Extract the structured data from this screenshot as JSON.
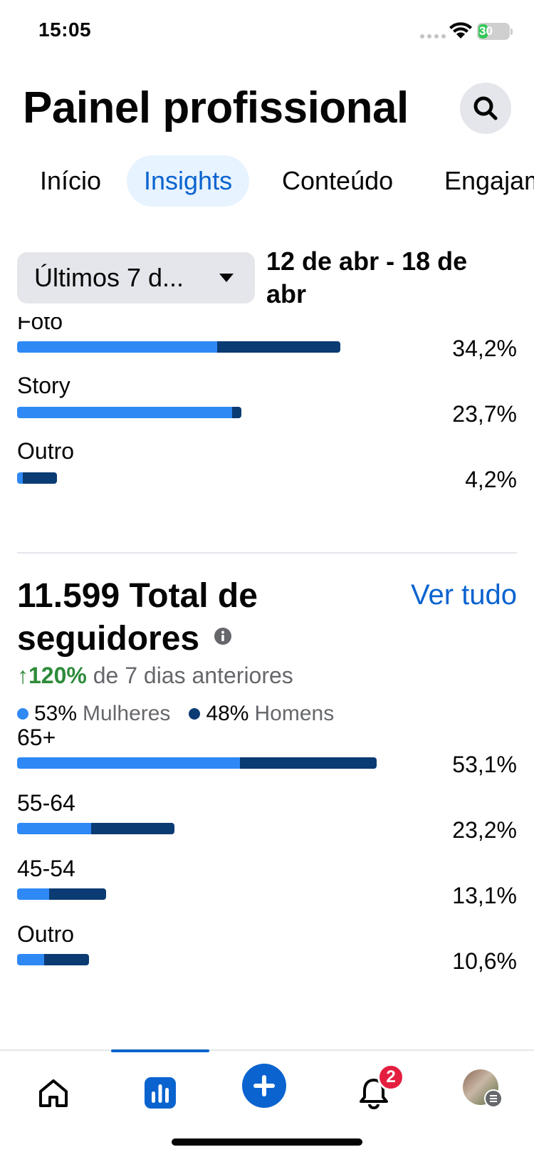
{
  "status_bar": {
    "time": "15:05",
    "battery": "30",
    "battery_level": 0.3
  },
  "header": {
    "title": "Painel profissional",
    "search_icon": "search-icon"
  },
  "tabs": [
    {
      "label": "Início",
      "active": false
    },
    {
      "label": "Insights",
      "active": true
    },
    {
      "label": "Conteúdo",
      "active": false
    },
    {
      "label": "Engajamento",
      "active": false
    }
  ],
  "filter": {
    "range_label": "Últimos 7 d...",
    "dates": "12 de abr - 18 de abr"
  },
  "content_types": [
    {
      "label": "Foto",
      "value": "34,2%",
      "share_a": 62,
      "share_b": 38
    },
    {
      "label": "Story",
      "value": "23,7%",
      "share_a": 96,
      "share_b": 4
    },
    {
      "label": "Outro",
      "value": "4,2%",
      "share_a": 15,
      "share_b": 85
    }
  ],
  "followers": {
    "title": "11.599 Total de seguidores",
    "see_all": "Ver tudo",
    "growth_pct": "↑120%",
    "growth_text": "de 7 dias anteriores",
    "legend": [
      {
        "pct": "53%",
        "name": "Mulheres",
        "color": "#2e89f5"
      },
      {
        "pct": "48%",
        "name": "Homens",
        "color": "#0a3b73"
      }
    ],
    "age_groups": [
      {
        "label": "65+",
        "value": "53,1%",
        "share_a": 62,
        "share_b": 38
      },
      {
        "label": "55-64",
        "value": "23,2%",
        "share_a": 47,
        "share_b": 53
      },
      {
        "label": "45-54",
        "value": "13,1%",
        "share_a": 36,
        "share_b": 64
      },
      {
        "label": "Outro",
        "value": "10,6%",
        "share_a": 38,
        "share_b": 62
      }
    ]
  },
  "bottom_nav": {
    "items": [
      "home-icon",
      "insights-icon",
      "create-icon",
      "notifications-icon",
      "profile-avatar"
    ],
    "notification_count": "2"
  },
  "colors": {
    "accent": "#0a63cf",
    "bar_light": "#2e89f5",
    "bar_dark": "#0a3b73",
    "growth": "#2e8b3a",
    "badge": "#e41e3f"
  }
}
